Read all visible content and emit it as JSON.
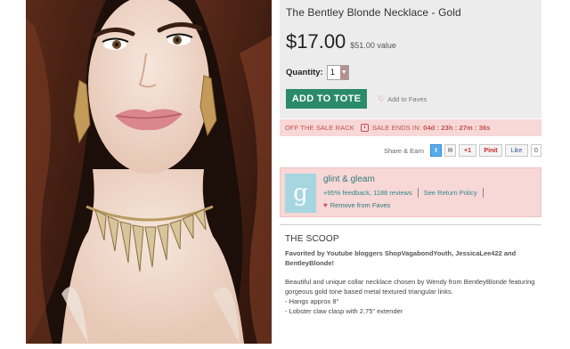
{
  "product": {
    "title": "The Bentley Blonde Necklace - Gold",
    "price": "$17.00",
    "value": "$51.00 value",
    "quantity_label": "Quantity:",
    "quantity_value": "1",
    "add_to_tote": "ADD TO TOTE",
    "add_to_faves": "Add to Faves"
  },
  "sale": {
    "rack": "OFF THE SALE RACK",
    "ends_label": "SALE ENDS IN:",
    "countdown": "04d : 23h : 27m : 36s"
  },
  "share": {
    "label": "Share & Earn",
    "twitter": "t",
    "gplus": "+1",
    "pinterest": "Pinit",
    "facebook": "Like",
    "count": "0"
  },
  "seller": {
    "logo_letter": "g",
    "name": "glint & gleam",
    "feedback": "+95% feedback, 1188 reviews",
    "return_policy": "See Return Policy",
    "remove_faves": "Remove from Faves"
  },
  "scoop": {
    "heading": "THE SCOOP",
    "highlight": "Favorited by Youtube bloggers ShopVagabondYouth, JessicaLee422 and BentleyBlonde!",
    "description": "Beautiful and unique collar necklace chosen by Wendy from BentleyBlonde featuring gorgeous gold tone based metal textured triangular links.",
    "bullet_1": "- Hangs approx 8\"",
    "bullet_2": "- Lobster claw clasp with 2.75\" extender"
  },
  "colors": {
    "accent_green": "#2b8a6a",
    "sale_pink": "#f8d7d7",
    "sale_text": "#c0504d",
    "seller_teal": "#2f7c7a"
  }
}
